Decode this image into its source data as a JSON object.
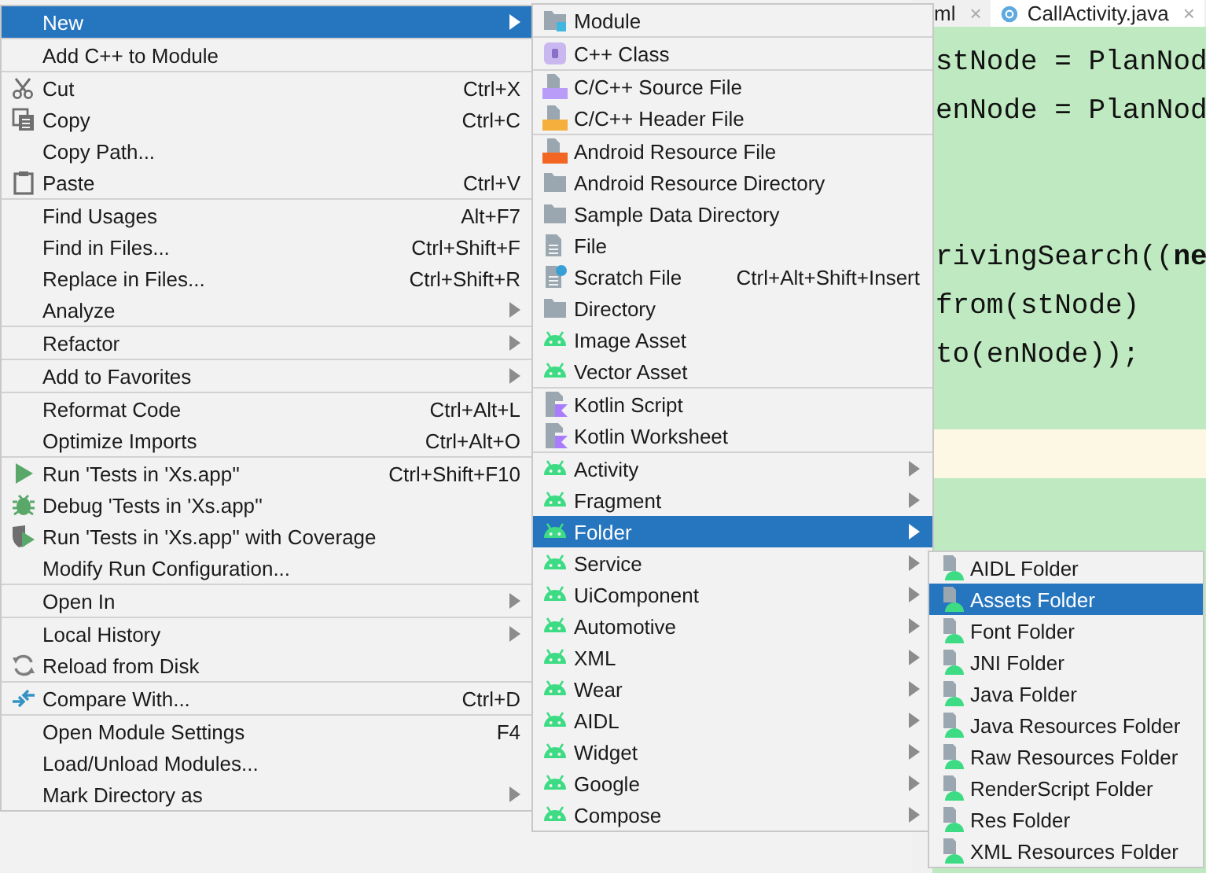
{
  "editor": {
    "tabs": [
      {
        "label": "ml",
        "close": "×",
        "selected": false
      },
      {
        "label": "CallActivity.java",
        "close": "×",
        "selected": true
      }
    ],
    "lines": [
      {
        "kind": "code",
        "text": "stNode = PlanNod",
        "highlighted": false
      },
      {
        "kind": "code",
        "text": "enNode = PlanNod",
        "highlighted": false
      },
      {
        "kind": "blank"
      },
      {
        "kind": "blank"
      },
      {
        "kind": "code",
        "text": "rivingSearch((**ne**",
        "highlighted": false
      },
      {
        "kind": "code",
        "text": "from(stNode)",
        "highlighted": false
      },
      {
        "kind": "code",
        "text": "to(enNode));",
        "highlighted": false
      },
      {
        "kind": "blank"
      },
      {
        "kind": "blank",
        "highlighted": true
      }
    ]
  },
  "menus": [
    {
      "groups": [
        [
          {
            "label": "New",
            "kind": "plain",
            "submenu": true,
            "selected": true
          }
        ],
        [
          {
            "label": "Add C++ to Module",
            "kind": "plain",
            "submenu": false,
            "selected": false
          }
        ],
        [
          {
            "label": "Cut",
            "shortcut": "Ctrl+X",
            "kind": "scissors",
            "submenu": false,
            "selected": false
          },
          {
            "label": "Copy",
            "shortcut": "Ctrl+C",
            "kind": "copy",
            "submenu": false,
            "selected": false
          },
          {
            "label": "Copy Path...",
            "kind": "plain",
            "submenu": false,
            "selected": false
          },
          {
            "label": "Paste",
            "shortcut": "Ctrl+V",
            "kind": "clipboard",
            "submenu": false,
            "selected": false
          }
        ],
        [
          {
            "label": "Find Usages",
            "shortcut": "Alt+F7",
            "kind": "plain",
            "submenu": false,
            "selected": false
          },
          {
            "label": "Find in Files...",
            "shortcut": "Ctrl+Shift+F",
            "kind": "plain",
            "submenu": false,
            "selected": false
          },
          {
            "label": "Replace in Files...",
            "shortcut": "Ctrl+Shift+R",
            "kind": "plain",
            "submenu": false,
            "selected": false
          },
          {
            "label": "Analyze",
            "kind": "plain",
            "submenu": true,
            "selected": false
          }
        ],
        [
          {
            "label": "Refactor",
            "kind": "plain",
            "submenu": true,
            "selected": false
          }
        ],
        [
          {
            "label": "Add to Favorites",
            "kind": "plain",
            "submenu": true,
            "selected": false
          }
        ],
        [
          {
            "label": "Reformat Code",
            "shortcut": "Ctrl+Alt+L",
            "kind": "plain",
            "submenu": false,
            "selected": false
          },
          {
            "label": "Optimize Imports",
            "shortcut": "Ctrl+Alt+O",
            "kind": "plain",
            "submenu": false,
            "selected": false
          }
        ],
        [
          {
            "label": "Run 'Tests in 'Xs.app''",
            "shortcut": "Ctrl+Shift+F10",
            "kind": "run",
            "submenu": false,
            "selected": false
          },
          {
            "label": "Debug 'Tests in 'Xs.app''",
            "kind": "debug",
            "submenu": false,
            "selected": false
          },
          {
            "label": "Run 'Tests in 'Xs.app'' with Coverage",
            "kind": "coverage",
            "submenu": false,
            "selected": false
          },
          {
            "label": "Modify Run Configuration...",
            "kind": "plain",
            "submenu": false,
            "selected": false
          }
        ],
        [
          {
            "label": "Open In",
            "kind": "plain",
            "submenu": true,
            "selected": false
          }
        ],
        [
          {
            "label": "Local History",
            "kind": "plain",
            "submenu": true,
            "selected": false
          },
          {
            "label": "Reload from Disk",
            "kind": "reload",
            "submenu": false,
            "selected": false
          }
        ],
        [
          {
            "label": "Compare With...",
            "shortcut": "Ctrl+D",
            "kind": "compare",
            "submenu": false,
            "selected": false
          }
        ],
        [
          {
            "label": "Open Module Settings",
            "shortcut": "F4",
            "kind": "plain",
            "submenu": false,
            "selected": false
          },
          {
            "label": "Load/Unload Modules...",
            "kind": "plain",
            "submenu": false,
            "selected": false
          },
          {
            "label": "Mark Directory as",
            "kind": "plain",
            "submenu": true,
            "selected": false
          }
        ]
      ]
    },
    {
      "groups": [
        [
          {
            "label": "Module",
            "kind": "module",
            "submenu": false,
            "selected": false
          }
        ],
        [
          {
            "label": "C++ Class",
            "kind": "cppclass",
            "submenu": false,
            "selected": false
          }
        ],
        [
          {
            "label": "C/C++ Source File",
            "kind": "source",
            "submenu": false,
            "selected": false
          },
          {
            "label": "C/C++ Header File",
            "kind": "header",
            "submenu": false,
            "selected": false
          }
        ],
        [
          {
            "label": "Android Resource File",
            "kind": "resource",
            "submenu": false,
            "selected": false
          },
          {
            "label": "Android Resource Directory",
            "kind": "folder",
            "submenu": false,
            "selected": false
          },
          {
            "label": "Sample Data Directory",
            "kind": "folder",
            "submenu": false,
            "selected": false
          },
          {
            "label": "File",
            "kind": "file",
            "submenu": false,
            "selected": false
          },
          {
            "label": "Scratch File",
            "shortcut": "Ctrl+Alt+Shift+Insert",
            "kind": "scratch",
            "submenu": false,
            "selected": false
          },
          {
            "label": "Directory",
            "kind": "folder",
            "submenu": false,
            "selected": false
          },
          {
            "label": "Image Asset",
            "kind": "android",
            "submenu": false,
            "selected": false
          },
          {
            "label": "Vector Asset",
            "kind": "android",
            "submenu": false,
            "selected": false
          }
        ],
        [
          {
            "label": "Kotlin Script",
            "kind": "kotlin",
            "submenu": false,
            "selected": false
          },
          {
            "label": "Kotlin Worksheet",
            "kind": "kotlin",
            "submenu": false,
            "selected": false
          }
        ],
        [
          {
            "label": "Activity",
            "kind": "android",
            "submenu": true,
            "selected": false
          },
          {
            "label": "Fragment",
            "kind": "android",
            "submenu": true,
            "selected": false
          },
          {
            "label": "Folder",
            "kind": "android",
            "submenu": true,
            "selected": true
          },
          {
            "label": "Service",
            "kind": "android",
            "submenu": true,
            "selected": false
          },
          {
            "label": "UiComponent",
            "kind": "android",
            "submenu": true,
            "selected": false
          },
          {
            "label": "Automotive",
            "kind": "android",
            "submenu": true,
            "selected": false
          },
          {
            "label": "XML",
            "kind": "android",
            "submenu": true,
            "selected": false
          },
          {
            "label": "Wear",
            "kind": "android",
            "submenu": true,
            "selected": false
          },
          {
            "label": "AIDL",
            "kind": "android",
            "submenu": true,
            "selected": false
          },
          {
            "label": "Widget",
            "kind": "android",
            "submenu": true,
            "selected": false
          },
          {
            "label": "Google",
            "kind": "android",
            "submenu": true,
            "selected": false
          },
          {
            "label": "Compose",
            "kind": "android",
            "submenu": true,
            "selected": false
          }
        ]
      ]
    },
    {
      "groups": [
        [
          {
            "label": "AIDL Folder",
            "kind": "androidfile",
            "submenu": false,
            "selected": false
          },
          {
            "label": "Assets Folder",
            "kind": "androidfile",
            "submenu": false,
            "selected": true
          },
          {
            "label": "Font Folder",
            "kind": "androidfile",
            "submenu": false,
            "selected": false
          },
          {
            "label": "JNI Folder",
            "kind": "androidfile",
            "submenu": false,
            "selected": false
          },
          {
            "label": "Java Folder",
            "kind": "androidfile",
            "submenu": false,
            "selected": false
          },
          {
            "label": "Java Resources Folder",
            "kind": "androidfile",
            "submenu": false,
            "selected": false
          },
          {
            "label": "Raw Resources Folder",
            "kind": "androidfile",
            "submenu": false,
            "selected": false
          },
          {
            "label": "RenderScript Folder",
            "kind": "androidfile",
            "submenu": false,
            "selected": false
          },
          {
            "label": "Res Folder",
            "kind": "androidfile",
            "submenu": false,
            "selected": false
          },
          {
            "label": "XML Resources Folder",
            "kind": "androidfile",
            "submenu": false,
            "selected": false
          }
        ]
      ]
    }
  ]
}
